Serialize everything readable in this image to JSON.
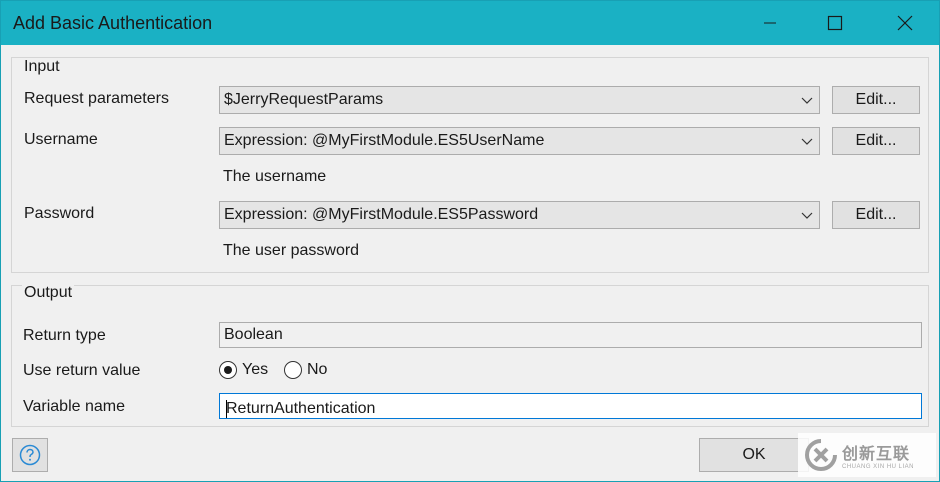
{
  "window": {
    "title": "Add Basic Authentication",
    "minimize_icon": "minimize-icon",
    "maximize_icon": "maximize-icon",
    "close_icon": "close-icon",
    "titlebar_color": "#1ab1c4"
  },
  "input": {
    "group_label": "Input",
    "request_parameters": {
      "label": "Request parameters",
      "value": "$JerryRequestParams",
      "edit_label": "Edit..."
    },
    "username": {
      "label": "Username",
      "value": "Expression: @MyFirstModule.ES5UserName",
      "edit_label": "Edit...",
      "hint": "The username"
    },
    "password": {
      "label": "Password",
      "value": "Expression: @MyFirstModule.ES5Password",
      "edit_label": "Edit...",
      "hint": "The user password"
    }
  },
  "output": {
    "group_label": "Output",
    "return_type": {
      "label": "Return type",
      "value": "Boolean"
    },
    "use_return_value": {
      "label": "Use return value",
      "options": [
        "Yes",
        "No"
      ],
      "selected": "Yes"
    },
    "variable_name": {
      "label": "Variable name",
      "value": "ReturnAuthentication"
    }
  },
  "footer": {
    "help_icon": "help-icon",
    "ok_label": "OK"
  },
  "watermark": {
    "main": "创新互联",
    "sub": "CHUANG XIN HU LIAN"
  }
}
